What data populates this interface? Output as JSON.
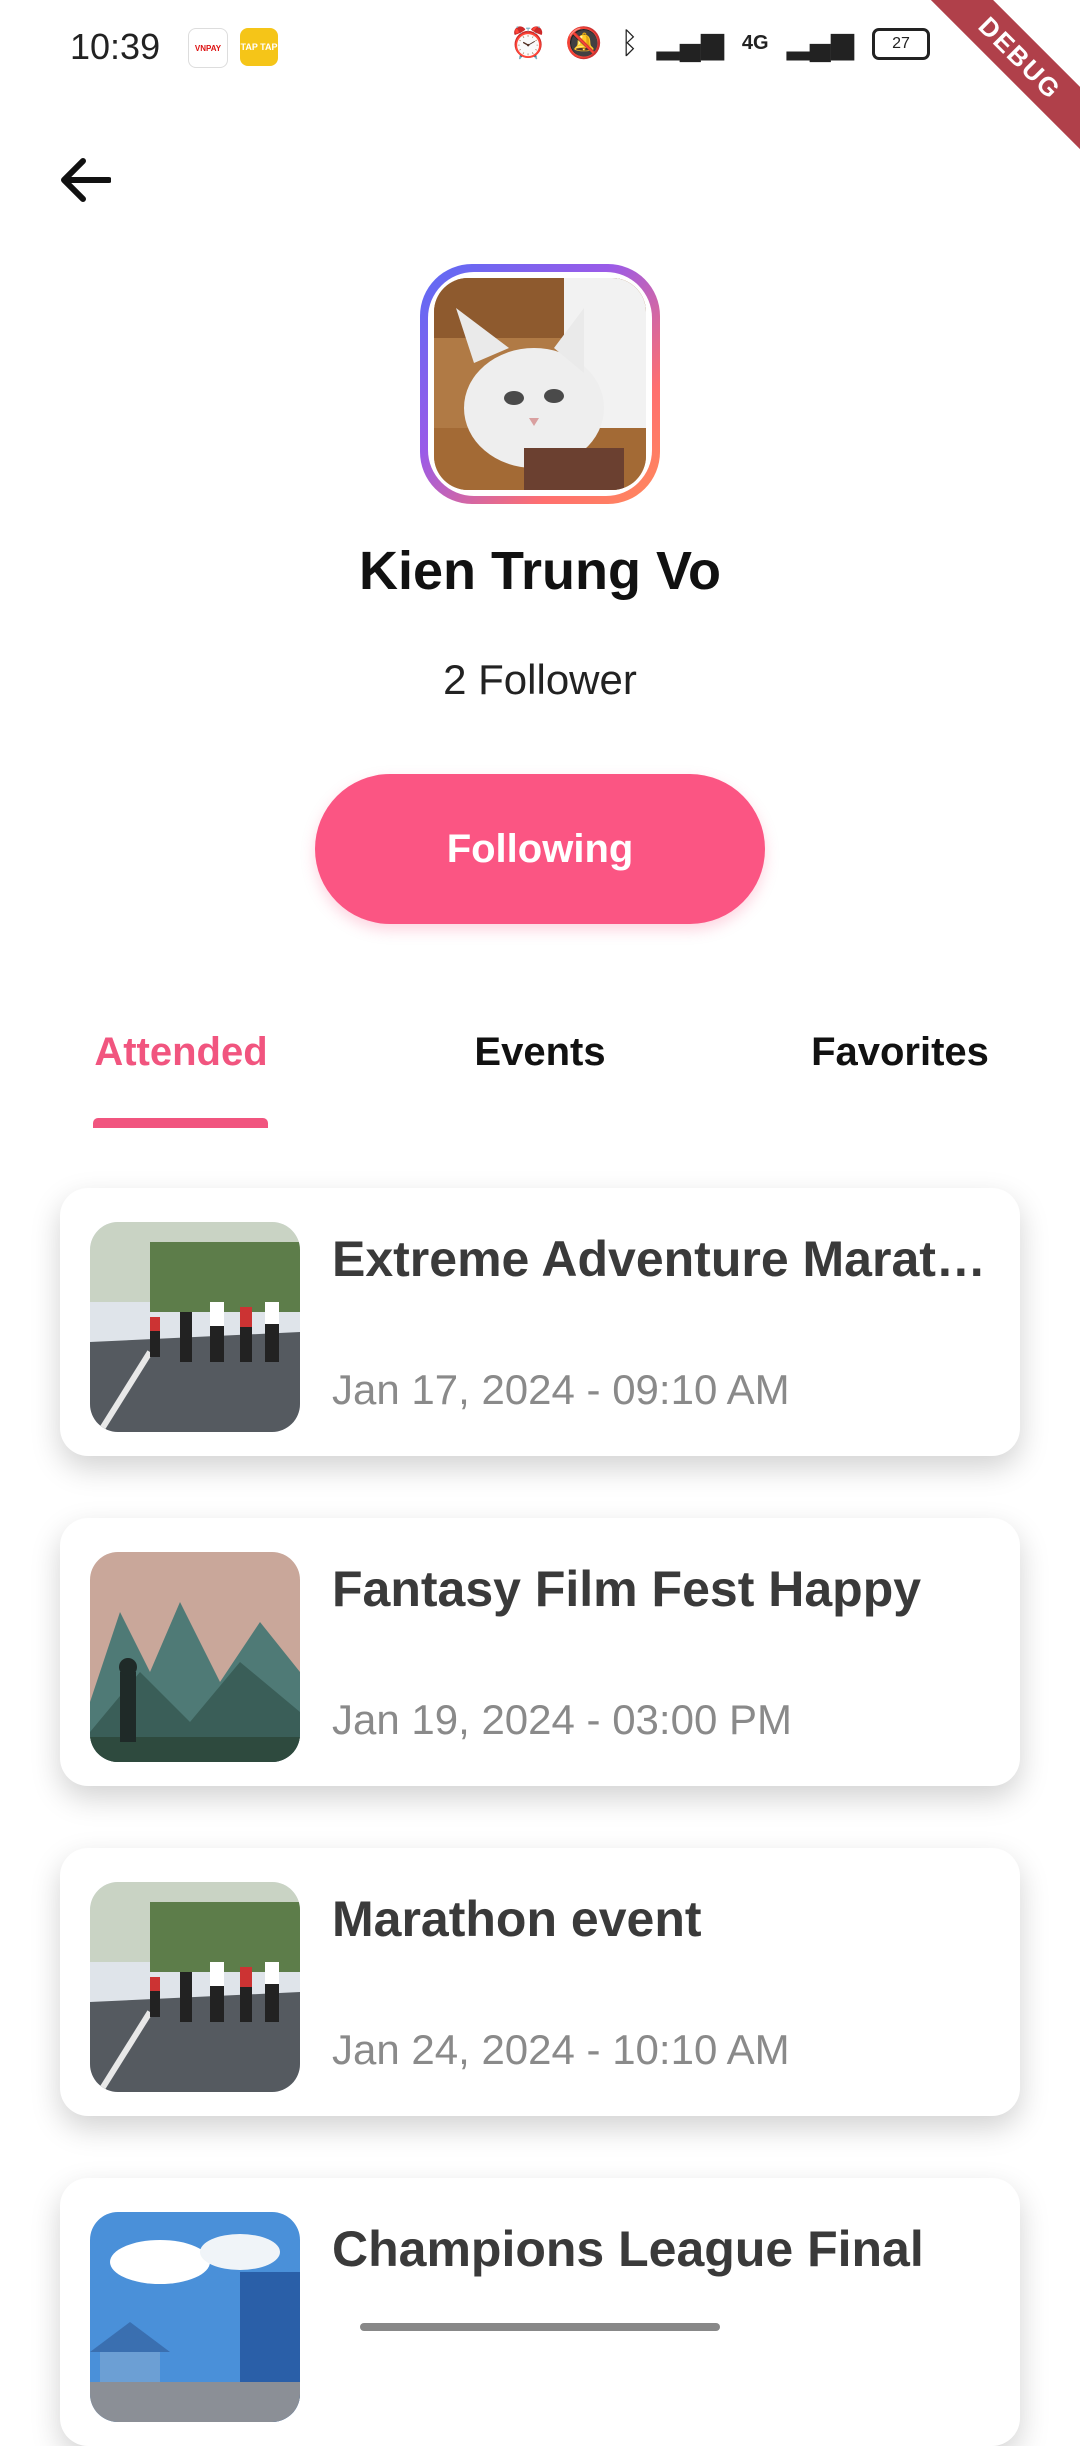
{
  "status_bar": {
    "time": "10:39",
    "app_badges": [
      "VNPAY",
      "TAP TAP"
    ],
    "network": "4G",
    "battery": "27",
    "debug_label": "DEBUG"
  },
  "header": {
    "back_icon": "arrow-left-icon"
  },
  "profile": {
    "name": "Kien Trung Vo",
    "followers": "2 Follower",
    "follow_button_label": "Following",
    "avatar_icon": "cat-photo"
  },
  "tabs": [
    {
      "label": "Attended",
      "active": true
    },
    {
      "label": "Events",
      "active": false
    },
    {
      "label": "Favorites",
      "active": false
    }
  ],
  "events": [
    {
      "title": "Extreme Adventure Marathon",
      "date": "Jan 17, 2024 - 09:10 AM",
      "thumb": "marathon-photo"
    },
    {
      "title": "Fantasy Film Fest Happy",
      "date": "Jan 19, 2024 - 03:00 PM",
      "thumb": "fantasy-landscape-photo"
    },
    {
      "title": "Marathon event",
      "date": "Jan 24, 2024 - 10:10 AM",
      "thumb": "marathon-photo"
    },
    {
      "title": "Champions League Final",
      "date": "",
      "thumb": "village-photo"
    }
  ],
  "colors": {
    "accent": "#fb5583",
    "tab_active": "#f1557f",
    "title_text": "#3a3a3a",
    "date_text": "#8a8a8a"
  }
}
